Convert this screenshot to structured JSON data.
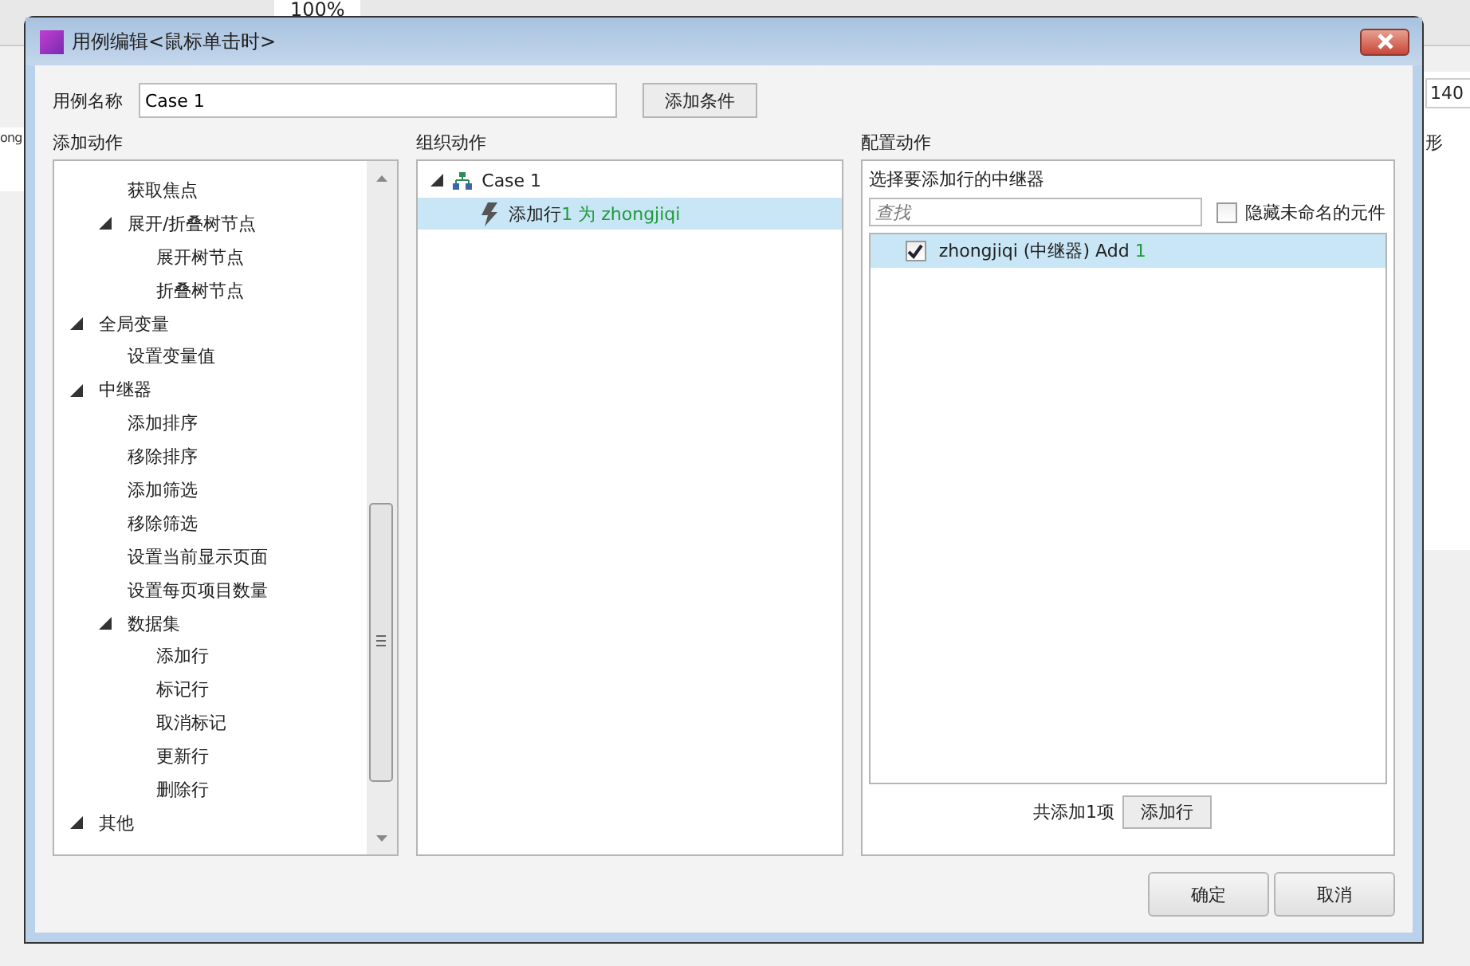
{
  "background": {
    "zoom": "100%",
    "field_value": "140",
    "side_text": "形",
    "left_text": "ong"
  },
  "dialog": {
    "title": "用例编辑<鼠标单击时>",
    "case_name": {
      "label": "用例名称",
      "value": "Case 1"
    },
    "add_condition_button": "添加条件",
    "add_actions": {
      "heading": "添加动作",
      "tree": [
        {
          "children": [
            {
              "label": "获取焦点"
            },
            {
              "label": "展开/折叠树节点",
              "expanded": true,
              "children": [
                {
                  "label": "展开树节点"
                },
                {
                  "label": "折叠树节点"
                }
              ]
            }
          ]
        },
        {
          "label": "全局变量",
          "expanded": true,
          "children": [
            {
              "label": "设置变量值"
            }
          ]
        },
        {
          "label": "中继器",
          "expanded": true,
          "children": [
            {
              "label": "添加排序"
            },
            {
              "label": "移除排序"
            },
            {
              "label": "添加筛选"
            },
            {
              "label": "移除筛选"
            },
            {
              "label": "设置当前显示页面"
            },
            {
              "label": "设置每页项目数量"
            },
            {
              "label": "数据集",
              "expanded": true,
              "children": [
                {
                  "label": "添加行"
                },
                {
                  "label": "标记行"
                },
                {
                  "label": "取消标记"
                },
                {
                  "label": "更新行"
                },
                {
                  "label": "删除行"
                }
              ]
            }
          ]
        },
        {
          "label": "其他",
          "expanded": true
        }
      ]
    },
    "organize_actions": {
      "heading": "组织动作",
      "cases": [
        {
          "label": "Case 1",
          "expanded": true,
          "actions": [
            {
              "name": "添加行",
              "detail": "1 为 zhongjiqi",
              "selected": true
            }
          ]
        }
      ]
    },
    "configure_actions": {
      "heading": "配置动作",
      "prompt": "选择要添加行的中继器",
      "search": {
        "placeholder": "查找"
      },
      "hide_unnamed": {
        "label": "隐藏未命名的元件",
        "checked": false
      },
      "repeaters": [
        {
          "name": "zhongjiqi (中继器) Add",
          "count": "1",
          "checked": true,
          "selected": true
        }
      ],
      "total": "共添加1项",
      "add_row_button": "添加行"
    },
    "buttons": [
      "确定",
      "取消"
    ]
  }
}
